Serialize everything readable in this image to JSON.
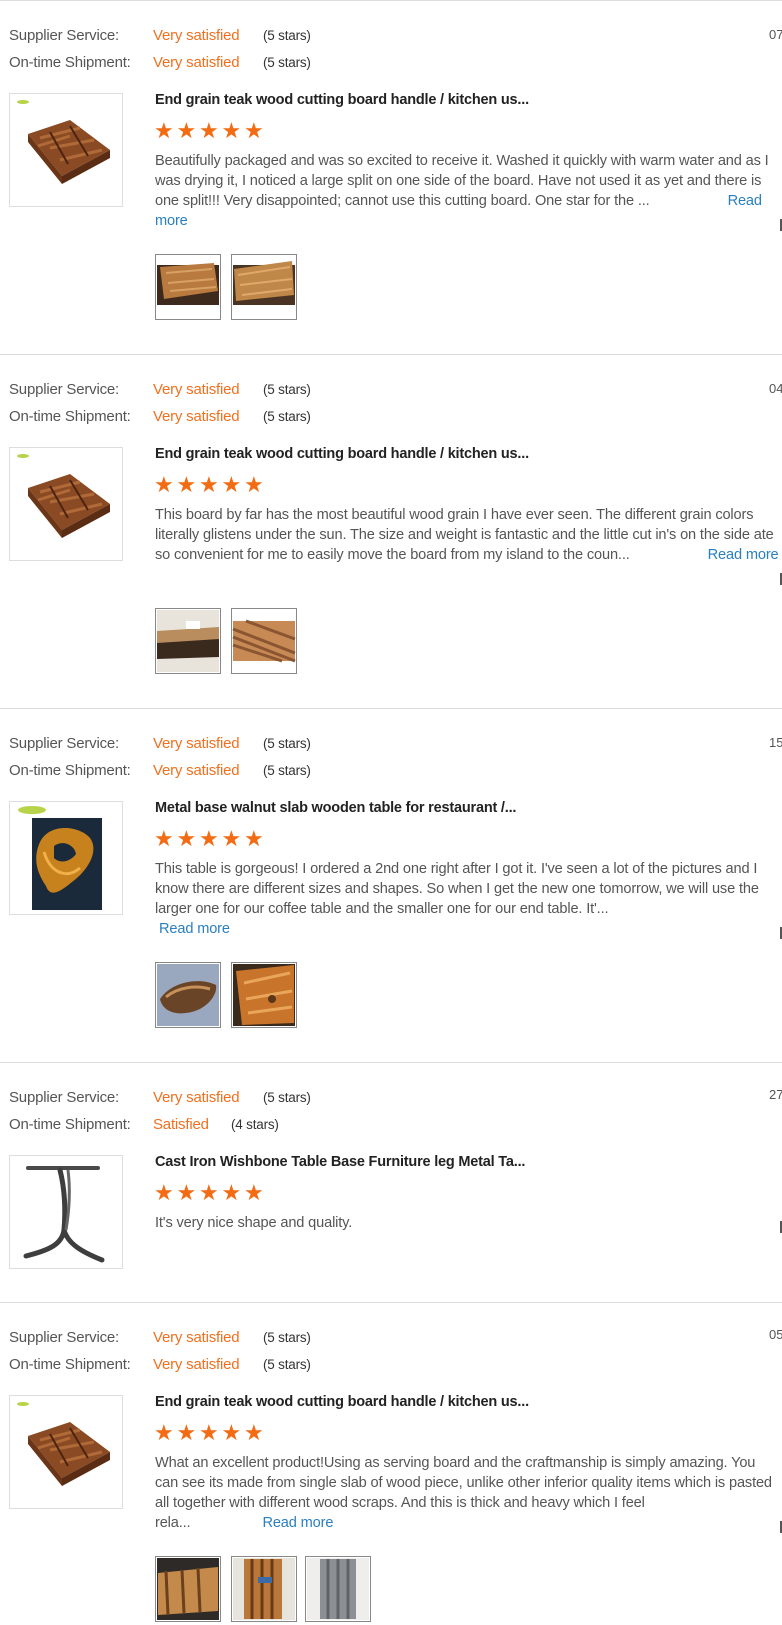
{
  "labels": {
    "supplier": "Supplier Service:",
    "shipment": "On-time Shipment:",
    "read_more": "Read more"
  },
  "reviews": [
    {
      "date": "07",
      "supplier_rating": "Very satisfied",
      "supplier_stars": "(5 stars)",
      "shipment_rating": "Very satisfied",
      "shipment_stars": "(5 stars)",
      "product_title": "End grain teak wood cutting board handle / kitchen us...",
      "stars": 5,
      "text": "Beautifully packaged and was so excited to receive it. Washed it quickly with warm water and as I was drying it, I noticed a large split on one side of the board. Have not used it as yet and there is one split!!! Very disappointed; cannot use this cutting board. One star for the ...",
      "photos": 2
    },
    {
      "date": "04",
      "supplier_rating": "Very satisfied",
      "supplier_stars": "(5 stars)",
      "shipment_rating": "Very satisfied",
      "shipment_stars": "(5 stars)",
      "product_title": "End grain teak wood cutting board handle / kitchen us...",
      "stars": 5,
      "text": "This board by far has the most beautiful wood grain I have ever seen. The different grain colors literally glistens under the sun. The size and weight is fantastic and the little cut in's on the side ate so convenient for me to easily move the board from my island to the coun...",
      "photos": 2
    },
    {
      "date": "15",
      "supplier_rating": "Very satisfied",
      "supplier_stars": "(5 stars)",
      "shipment_rating": "Very satisfied",
      "shipment_stars": "(5 stars)",
      "product_title": "Metal base walnut slab wooden table for restaurant /...",
      "stars": 5,
      "text": "This table is gorgeous! I ordered a 2nd one right after I got it. I've seen a lot of the pictures and I know there are different sizes and shapes. So when I get the new one tomorrow, we will use the larger one for our coffee table and the smaller one for our end table. It'...",
      "photos": 2
    },
    {
      "date": "27",
      "supplier_rating": "Very satisfied",
      "supplier_stars": "(5 stars)",
      "shipment_rating": "Satisfied",
      "shipment_stars": "(4 stars)",
      "product_title": "Cast Iron Wishbone Table Base Furniture leg Metal Ta...",
      "stars": 5,
      "text": "It's very nice shape and quality.",
      "photos": 0
    },
    {
      "date": "05",
      "supplier_rating": "Very satisfied",
      "supplier_stars": "(5 stars)",
      "shipment_rating": "Very satisfied",
      "shipment_stars": "(5 stars)",
      "product_title": "End grain teak wood cutting board handle / kitchen us...",
      "stars": 5,
      "text": "What an excellent product!Using as serving board and the craftmanship is simply amazing. You can see its made from single slab of wood piece, unlike other inferior quality items which is pasted all together with different wood scraps. And this is thick and heavy which I feel rela...",
      "photos": 3
    }
  ],
  "colors": {
    "accent": "#f0701f",
    "star": "#f36b13",
    "link": "#2a7fc1"
  }
}
